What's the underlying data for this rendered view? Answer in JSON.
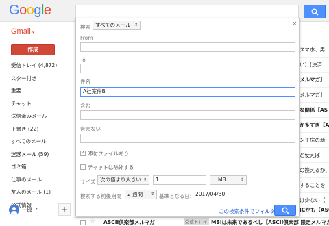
{
  "header": {
    "logo": [
      "G",
      "o",
      "o",
      "g",
      "l",
      "e"
    ]
  },
  "nav": {
    "app_label": "Gmail",
    "compose_label": "作成",
    "items": [
      {
        "label": "受信トレイ (4,872)",
        "bold": true
      },
      {
        "label": "スター付き",
        "bold": false
      },
      {
        "label": "重要",
        "bold": false
      },
      {
        "label": "チャット",
        "bold": false
      },
      {
        "label": "送信済みメール",
        "bold": false
      },
      {
        "label": "下書き (22)",
        "bold": true
      },
      {
        "label": "すべてのメール",
        "bold": false
      },
      {
        "label": "迷惑メール (59)",
        "bold": true
      },
      {
        "label": "ゴミ箱",
        "bold": false
      },
      {
        "label": "仕事のメール",
        "bold": false
      },
      {
        "label": "友人のメール (1)",
        "bold": true
      },
      {
        "label": "公式情報",
        "bold": false
      }
    ],
    "user_name": "一郎"
  },
  "email_list_edge": [
    {
      "text": "スマホ、男",
      "bold": false
    },
    {
      "text": "い】(決済",
      "bold": false
    },
    {
      "text": "メルマガ】",
      "bold": true
    },
    {
      "text": "メルマガ】",
      "bold": false
    },
    {
      "text": "な関係【AS",
      "bold": true
    },
    {
      "text": "か多すぎ【A",
      "bold": true
    },
    {
      "text": "ン工房の新",
      "bold": false
    },
    {
      "text": "ど使えば",
      "bold": false
    },
    {
      "text": "の換えるか、",
      "bold": false
    },
    {
      "text": "することを",
      "bold": false
    },
    {
      "text": "は少ない【",
      "bold": false
    },
    {
      "text": "ICかも【ASC",
      "bold": true
    }
  ],
  "bottom_row": {
    "sender": "ASCII倶楽部メルマガ",
    "label": "受信トレイ",
    "subject": "MSIは未来であるべし【ASCII倶楽部 限定メルマガ"
  },
  "search_panel": {
    "scope_label": "検索",
    "scope_value": "すべてのメール",
    "from_label": "From",
    "from_value": "",
    "to_label": "To",
    "to_value": "",
    "subject_label": "件名",
    "subject_value": "A社案件B",
    "includes_label": "含む",
    "includes_value": "",
    "excludes_label": "含まない",
    "excludes_value": "",
    "has_attachment_label": "添付ファイルあり",
    "has_attachment_checked": true,
    "exclude_chats_label": "チャットは除外する",
    "exclude_chats_checked": false,
    "size_label": "サイズ",
    "size_operator": "次の値より大きい",
    "size_value": "1",
    "size_unit": "MB",
    "date_range_label": "検索する前後期間",
    "date_range_value": "2 週間",
    "base_date_label": "基準となる日:",
    "base_date_value": "2017/04/30",
    "filter_link": "この検索条件でフィルタを作成 »"
  },
  "colors": {
    "compose": "#d14836",
    "search_button": "#4d90fe",
    "link": "#1155cc",
    "gmail_label": "#dd4b39"
  }
}
